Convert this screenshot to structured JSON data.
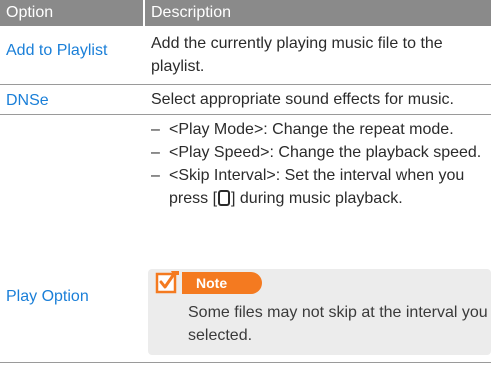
{
  "header": {
    "option": "Option",
    "description": "Description"
  },
  "rows": [
    {
      "option": "Add to Playlist",
      "description": "Add the currently playing music file to the playlist."
    },
    {
      "option": "DNSe",
      "description": "Select appropriate sound effects for music."
    },
    {
      "option": "Play Option",
      "bullets": [
        "<Play Mode>: Change the repeat mode.",
        "<Play Speed>: Change the playback speed.",
        "<Skip Interval>: Set the interval when you press [",
        "] during music playback."
      ],
      "dash": "–"
    }
  ],
  "note": {
    "title": "Note",
    "text": "Some files may not skip at the interval you selected."
  },
  "colors": {
    "header_bg": "#8a8a8a",
    "option_text": "#1a7fd8",
    "note_accent": "#f47a20",
    "note_bg": "#ececec"
  },
  "icons": {
    "note": "note-pencil-icon",
    "button": "play-pause-button-icon"
  }
}
